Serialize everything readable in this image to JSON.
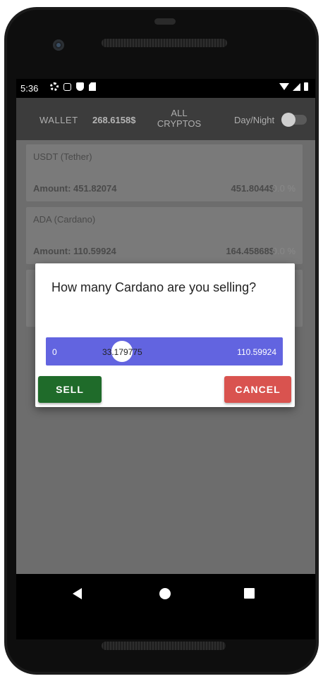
{
  "status_bar": {
    "time": "5:36"
  },
  "app_bar": {
    "wallet_label": "WALLET",
    "wallet_balance": "268.6158$",
    "all_cryptos_line1": "ALL",
    "all_cryptos_line2": "CRYPTOS",
    "day_night_label": "Day/Night",
    "day_night_on": false
  },
  "cards": [
    {
      "name": "USDT (Tether)",
      "amount": "Amount: 451.82074",
      "value": "451.8044$",
      "pct_value": "0.0",
      "pct_sign": "%"
    },
    {
      "name": "ADA (Cardano)",
      "amount": "Amount: 110.59924",
      "value": "164.45868$",
      "pct_value": "0.0",
      "pct_sign": "%"
    }
  ],
  "dialog": {
    "title": "How many Cardano are you selling?",
    "slider": {
      "min": "0",
      "max": "110.59924",
      "current": "33.179775"
    },
    "sell_label": "SELL",
    "cancel_label": "CANCEL"
  },
  "colors": {
    "slider": "#6264e0",
    "sell": "#1f6b2a",
    "cancel": "#d9534f",
    "app_bar": "#3c3c3c"
  }
}
